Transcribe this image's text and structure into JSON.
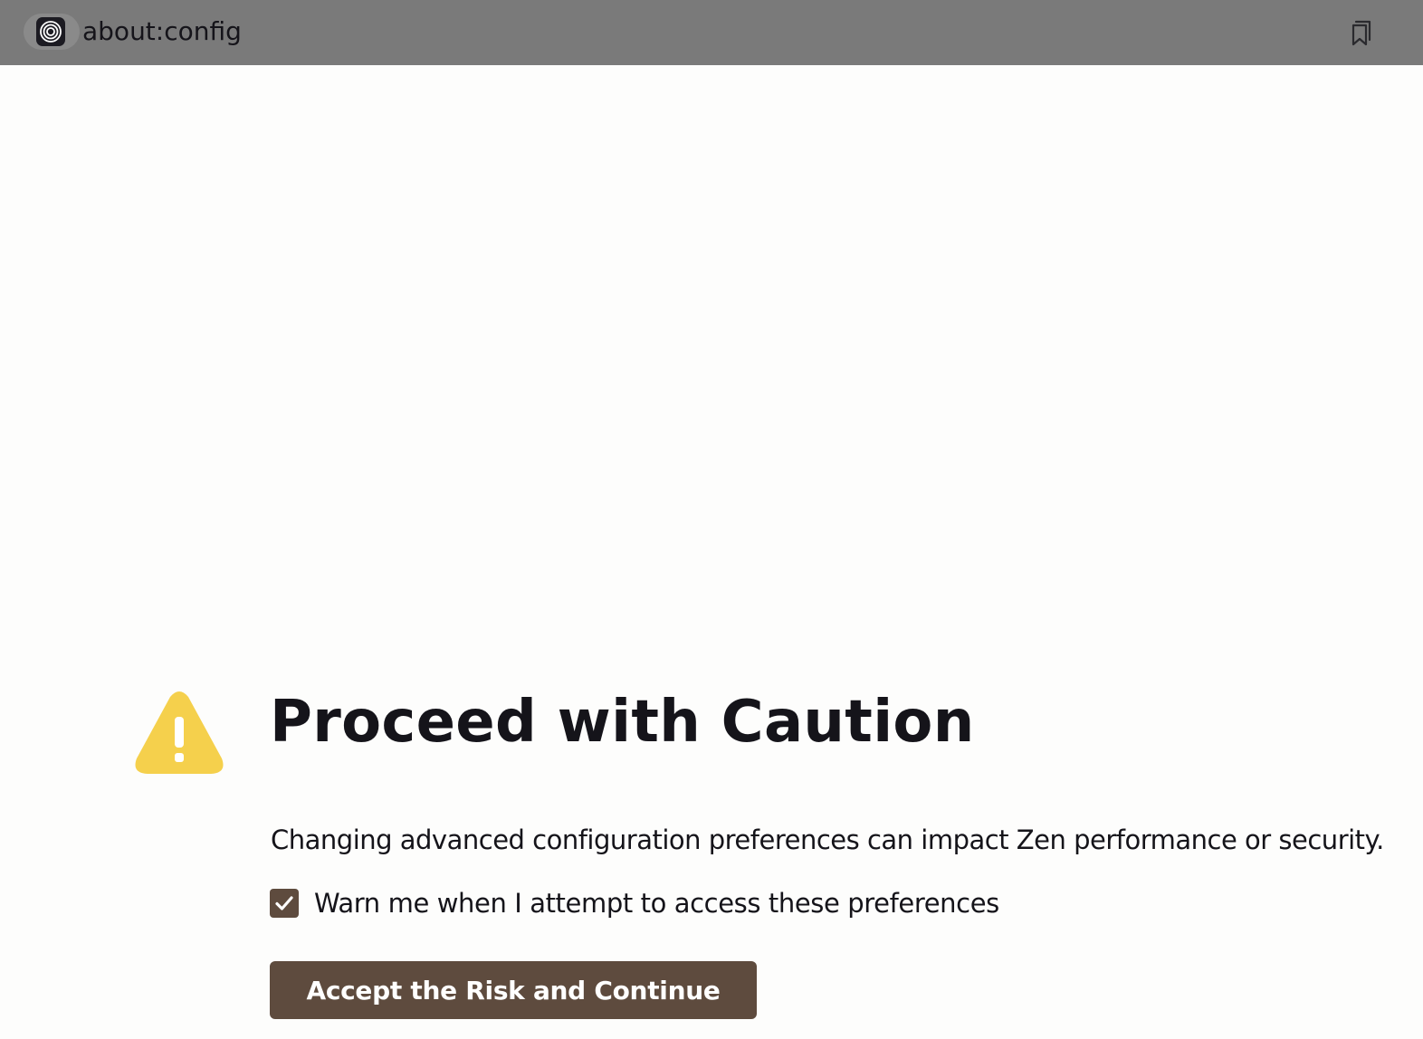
{
  "browser": {
    "url": "about:config"
  },
  "page": {
    "title": "Proceed with Caution",
    "description": "Changing advanced configuration preferences can impact Zen performance or security.",
    "warn_checkbox": {
      "label": "Warn me when I attempt to access these preferences",
      "checked": true
    },
    "accept_button_label": "Accept the Risk and Continue"
  },
  "colors": {
    "toolbar": "#7a7a7a",
    "accent": "#5e4b3e",
    "warning": "#f5d04c",
    "text": "#15141a"
  },
  "icons": {
    "identity": "zen-browser-logo-icon",
    "bookmark": "bookmark-icon",
    "warning": "warning-triangle-icon",
    "checkmark": "checkmark-icon"
  }
}
